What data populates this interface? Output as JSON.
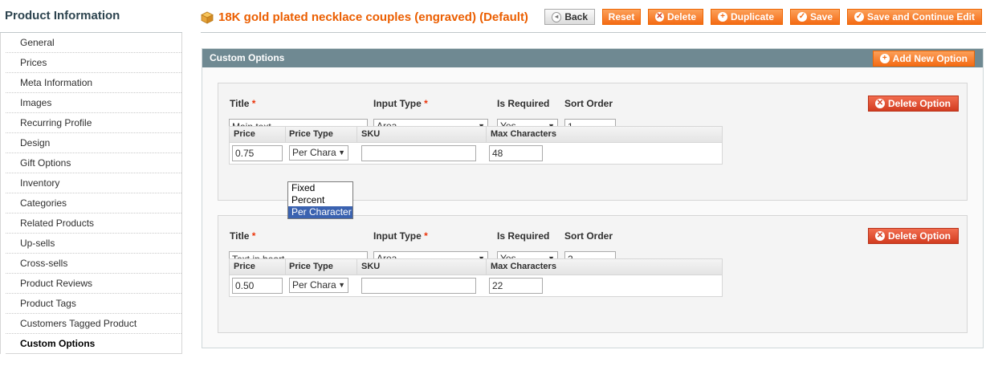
{
  "sidebar": {
    "title": "Product Information",
    "items": [
      "General",
      "Prices",
      "Meta Information",
      "Images",
      "Recurring Profile",
      "Design",
      "Gift Options",
      "Inventory",
      "Categories",
      "Related Products",
      "Up-sells",
      "Cross-sells",
      "Product Reviews",
      "Product Tags",
      "Customers Tagged Product",
      "Custom Options"
    ],
    "active_index": 15
  },
  "header": {
    "title": "18K gold plated necklace couples (engraved) (Default)",
    "buttons": {
      "back": "Back",
      "reset": "Reset",
      "delete": "Delete",
      "duplicate": "Duplicate",
      "save": "Save",
      "save_continue": "Save and Continue Edit"
    }
  },
  "panel": {
    "title": "Custom Options",
    "add_button": "Add New Option",
    "labels": {
      "title": "Title",
      "input_type": "Input Type",
      "is_required": "Is Required",
      "sort_order": "Sort Order",
      "delete_option": "Delete Option",
      "price": "Price",
      "price_type": "Price Type",
      "sku": "SKU",
      "max_chars": "Max Characters",
      "required_mark": "*"
    },
    "options": [
      {
        "title": "Main text",
        "input_type": "Area",
        "is_required": "Yes",
        "sort_order": "1",
        "price": "0.75",
        "price_type": "Per Chara",
        "sku": "",
        "max_chars": "48"
      },
      {
        "title": "Text in heart",
        "input_type": "Area",
        "is_required": "Yes",
        "sort_order": "2",
        "price": "0.50",
        "price_type": "Per Chara",
        "sku": "",
        "max_chars": "22"
      }
    ]
  },
  "price_type_dropdown": {
    "options": [
      "Fixed",
      "Percent",
      "Per Character"
    ],
    "highlighted": "Per Character"
  },
  "colors": {
    "accent": "#eb5e00",
    "button": "#f46b14",
    "panel_header": "#6f8992",
    "delete_button": "#d23c20",
    "highlight": "#3a62b0"
  }
}
